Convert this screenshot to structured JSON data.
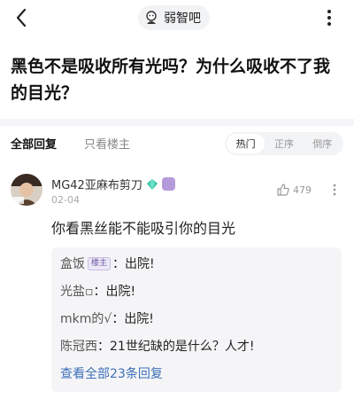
{
  "header": {
    "forum_name": "弱智吧"
  },
  "post": {
    "title": "黑色不是吸收所有光吗？为什么吸收不了我的目光？"
  },
  "filters": {
    "all_replies": "全部回复",
    "op_only": "只看楼主",
    "sort_options": [
      "热门",
      "正序",
      "倒序"
    ],
    "active_sort": "热门"
  },
  "comment": {
    "username": "MG42亚麻布剪刀",
    "date": "02-04",
    "likes": "479",
    "text": "你看黑丝能不能吸引你的目光",
    "replies": [
      {
        "name": "盒饭",
        "tag": "楼主",
        "text": "出院!"
      },
      {
        "name": "光盐▫",
        "tag": "",
        "text": "出院!"
      },
      {
        "name": "mkm的√",
        "tag": "",
        "text": "出院!"
      },
      {
        "name": "陈冠西",
        "tag": "",
        "text": "21世纪缺的是什么？人才!"
      }
    ],
    "view_all": "查看全部23条回复"
  },
  "colors": {
    "link": "#3d6fb8",
    "badge_green": "#2ec4a6",
    "level_purple": "#b59ad9"
  },
  "icons": {
    "back": "chevron-left-icon",
    "forum": "forum-logo-icon",
    "more": "more-dots-icon",
    "like": "thumbs-up-icon",
    "gem": "gem-badge-icon",
    "level": "level-badge-icon"
  }
}
